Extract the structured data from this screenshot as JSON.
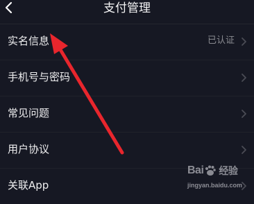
{
  "header": {
    "title": "支付管理"
  },
  "list": {
    "items": [
      {
        "label": "实名信息",
        "value": "已认证"
      },
      {
        "label": "手机号与密码",
        "value": ""
      },
      {
        "label": "常见问题",
        "value": ""
      },
      {
        "label": "用户协议",
        "value": ""
      },
      {
        "label": "关联App",
        "value": ""
      }
    ]
  },
  "annotation": {
    "color": "#e8262d"
  },
  "watermark": {
    "brand_left": "Bai",
    "brand_right": "经验",
    "url": "jingyan.baidu.com"
  },
  "colors": {
    "background": "#161823",
    "text_primary": "#eeeeef",
    "text_secondary": "#8a8b91"
  }
}
